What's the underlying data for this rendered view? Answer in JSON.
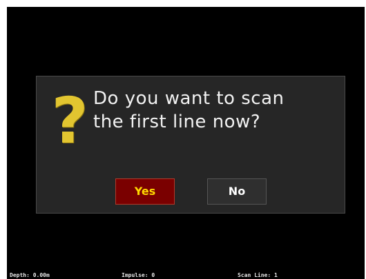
{
  "dialog": {
    "icon": "question-mark-icon",
    "icon_glyph": "?",
    "message_lines": [
      "Do you want to scan",
      "the first line now?"
    ],
    "yes_label": "Yes",
    "no_label": "No"
  },
  "status": {
    "depth": "Depth: 0.00m",
    "impulse": "Impulse: 0",
    "scan_line": "Scan Line: 1"
  },
  "colors": {
    "icon": "#e2c530",
    "yes_background": "#7a0000",
    "yes_text": "#ffd800",
    "dialog_background": "#262626"
  }
}
